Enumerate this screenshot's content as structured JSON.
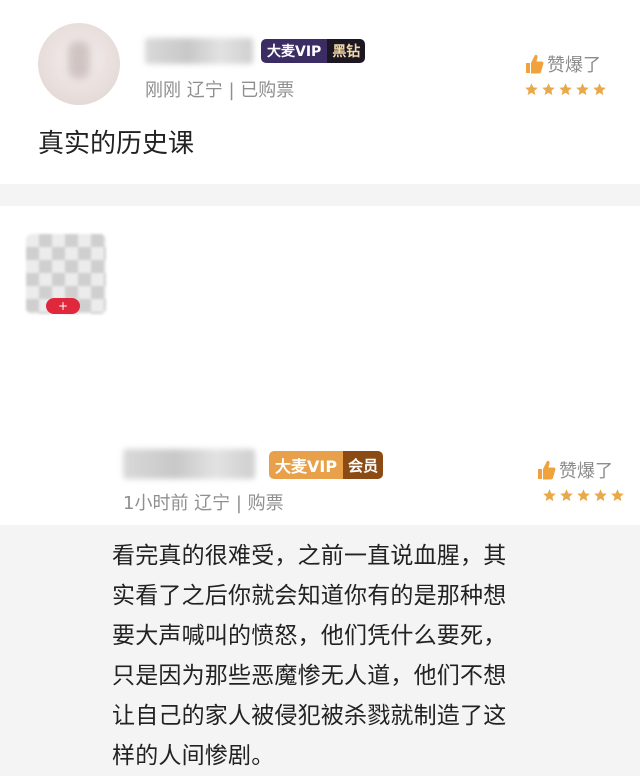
{
  "comments": [
    {
      "badge_main": "大麦VIP",
      "badge_tier": "黑钻",
      "meta": "刚刚  辽宁 | 已购票",
      "like_label": "赞爆了",
      "rating": 5,
      "text": "真实的历史课",
      "colors": {
        "badge_main": "#3b2c63",
        "badge_tier": "#1c1722",
        "star": "#e9a84a"
      }
    },
    {
      "avatar_badge": "+",
      "badge_main": "大麦VIP",
      "badge_tier": "会员",
      "meta": "1小时前  辽宁 | 购票",
      "like_label": "赞爆了",
      "rating": 5,
      "text": "看完真的很难受，之前一直说血腥，其实看了之后你就会知道你有的是那种想要大声喊叫的愤怒，他们凭什么要死，只是因为那些恶魔惨无人道，他们不想让自己的家人被侵犯被杀戮就制造了这样的人间惨剧。",
      "colors": {
        "badge_main": "#e8a14a",
        "badge_tier": "#8c4b14",
        "star": "#e9a84a"
      }
    }
  ],
  "icons": {
    "like": "thumbs-up-icon",
    "star": "star-icon"
  }
}
